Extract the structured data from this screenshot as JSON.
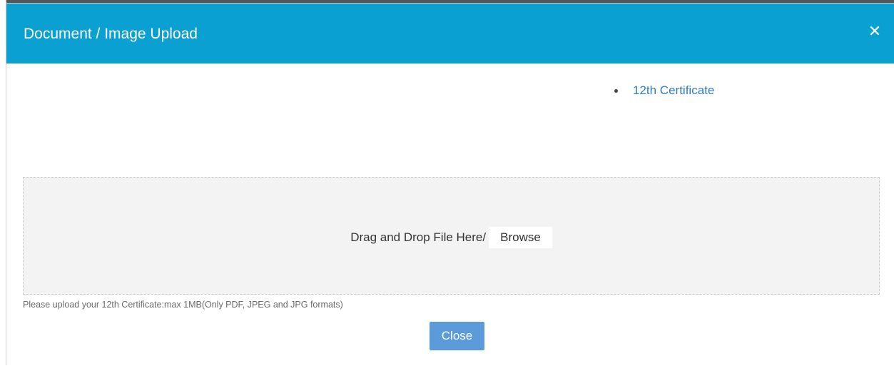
{
  "dialog": {
    "title": "Document / Image Upload",
    "close_icon": "close-icon",
    "documents": [
      {
        "label": "12th Certificate"
      }
    ],
    "dropzone": {
      "text": "Drag and Drop File Here/",
      "browse_label": "Browse"
    },
    "help_text": "Please upload your 12th Certificate:max 1MB(Only PDF, JPEG and JPG formats)",
    "close_button_label": "Close"
  },
  "colors": {
    "header": "#0aa0d1",
    "link": "#2f7bbf",
    "close_button": "#5b9bd9"
  }
}
